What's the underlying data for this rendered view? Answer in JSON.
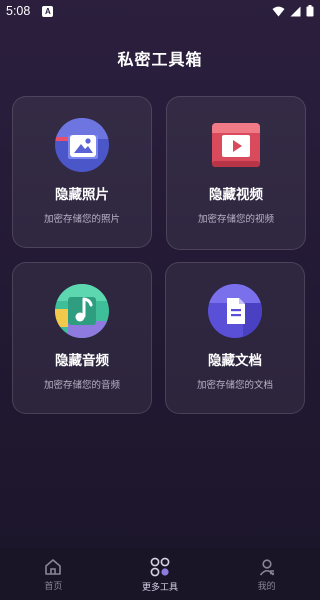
{
  "status_bar": {
    "time": "5:08",
    "notification_glyph": "A"
  },
  "page": {
    "title": "私密工具箱"
  },
  "cards": [
    {
      "title": "隐藏照片",
      "desc": "加密存储您的照片",
      "icon": "photo-icon"
    },
    {
      "title": "隐藏视频",
      "desc": "加密存储您的视频",
      "icon": "video-icon"
    },
    {
      "title": "隐藏音频",
      "desc": "加密存储您的音频",
      "icon": "music-icon"
    },
    {
      "title": "隐藏文档",
      "desc": "加密存储您的文档",
      "icon": "document-icon"
    }
  ],
  "bottom_nav": {
    "items": [
      {
        "label": "首页",
        "icon": "home-icon"
      },
      {
        "label": "更多工具",
        "icon": "tools-grid-icon",
        "active": true
      },
      {
        "label": "我的",
        "icon": "profile-icon"
      }
    ]
  },
  "colors": {
    "background_top": "#2b1f3d",
    "background_bottom": "#1b1529",
    "card_background": "rgba(255,255,255,0.06)",
    "nav_background": "#1a1526"
  }
}
